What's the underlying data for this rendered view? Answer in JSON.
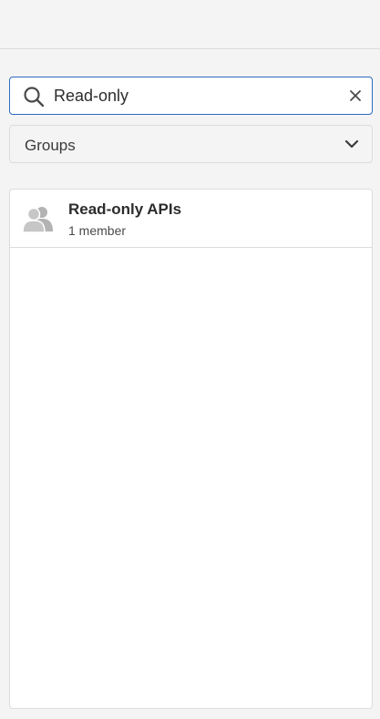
{
  "search": {
    "value": "Read-only",
    "icon": "search-icon",
    "clear_icon": "close-icon"
  },
  "filter": {
    "selected": "Groups",
    "icon": "chevron-down-icon"
  },
  "results": [
    {
      "title": "Read-only APIs",
      "subtitle": "1 member",
      "icon": "group-icon"
    }
  ],
  "colors": {
    "accent": "#2b6bbf",
    "background": "#f4f4f4",
    "border": "#dcdcdc",
    "icon": "#b3b3b3"
  }
}
